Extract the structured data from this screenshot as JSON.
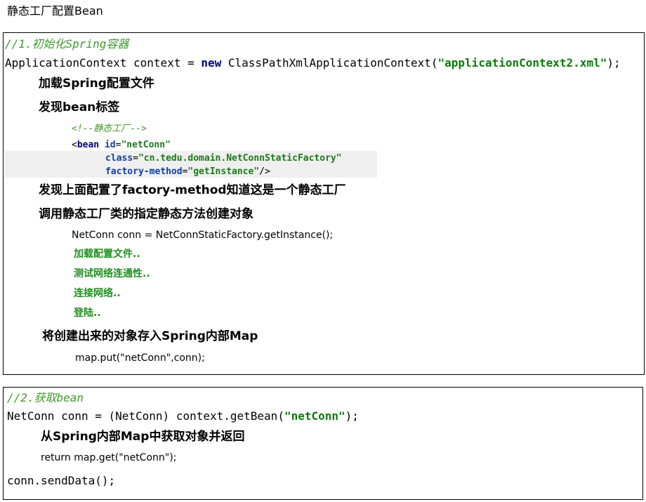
{
  "page": {
    "title": "静态工厂配置Bean"
  },
  "section1": {
    "comment": "//1.初始化Spring容器",
    "code_line": {
      "pre": "ApplicationContext context = ",
      "kw_new": "new",
      "mid": " ClassPathXmlApplicationContext(",
      "string": "\"applicationContext2.xml\"",
      "post": ");"
    },
    "step1": "加载Spring配置文件",
    "step2": "发现bean标签",
    "xml": {
      "comment": "<!--静态工厂-->",
      "open": "<",
      "tag": "bean",
      "attr_id": "id",
      "eq": "=",
      "val_id": "\"netConn\"",
      "attr_class": "class",
      "val_class": "\"cn.tedu.domain.NetConnStaticFactory\"",
      "attr_fm": "factory-method",
      "val_fm": "\"getInstance\"",
      "close": "/>"
    },
    "step3": "发现上面配置了factory-method知道这是一个静态工厂",
    "step4": "调用静态工厂类的指定静态方法创建对象",
    "factory_call": "NetConn conn = NetConnStaticFactory.getInstance();",
    "outputs": [
      "加载配置文件..",
      "测试网络连通性..",
      "连接网络..",
      "登陆.."
    ],
    "step5": "将创建出来的对象存入Spring内部Map",
    "map_put": "map.put(\"netConn\",conn);"
  },
  "section2": {
    "comment": "//2.获取bean",
    "code_line": {
      "pre": "NetConn conn = (NetConn) context.getBean(",
      "string": "\"netConn\"",
      "post": ");"
    },
    "step1": "从Spring内部Map中获取对象并返回",
    "return_line": "return map.get(\"netConn\");",
    "final_line": "conn.sendData();"
  }
}
